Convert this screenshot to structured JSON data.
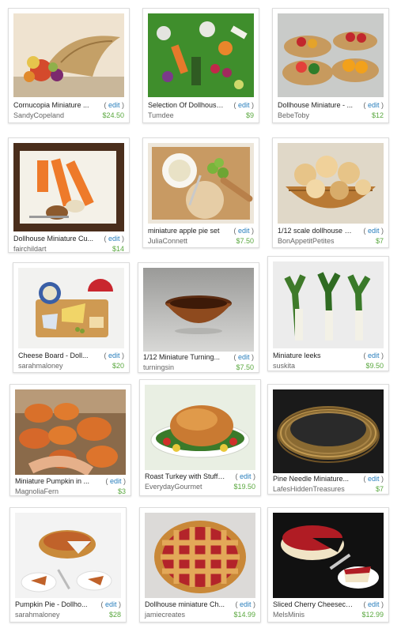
{
  "colors": {
    "edit": "#2a7fbd",
    "price": "#5aa83f",
    "shop": "#666666"
  },
  "edit_label": "edit",
  "items": [
    {
      "title": "Cornucopia Miniature ...",
      "shop": "SandyCopeland",
      "price": "$24.50",
      "icon": "cornucopia-image"
    },
    {
      "title": "Selection Of Dollhouse...",
      "shop": "Tumdee",
      "price": "$9",
      "icon": "vegetables-image"
    },
    {
      "title": "Dollhouse Miniature - ...",
      "shop": "BebeToby",
      "price": "$12",
      "icon": "fruit-baskets-image"
    },
    {
      "title": "Dollhouse Miniature Cu...",
      "shop": "fairchildart",
      "price": "$14",
      "icon": "cutting-board-image"
    },
    {
      "title": "miniature apple pie set",
      "shop": "JuliaConnett",
      "price": "$7.50",
      "icon": "apple-pie-set-image"
    },
    {
      "title": "1/12 scale dollhouse min...",
      "shop": "BonAppetitPetites",
      "price": "$7",
      "icon": "bread-basket-image"
    },
    {
      "title": "Cheese Board - Doll...",
      "shop": "sarahmaloney",
      "price": "$20",
      "icon": "cheese-board-image"
    },
    {
      "title": "1/12 Miniature Turning...",
      "shop": "turningsin",
      "price": "$7.50",
      "icon": "wooden-bowl-image"
    },
    {
      "title": "Miniature leeks",
      "shop": "suskita",
      "price": "$9.50",
      "icon": "leeks-image"
    },
    {
      "title": "Miniature Pumpkin in ...",
      "shop": "MagnoliaFern",
      "price": "$3",
      "icon": "pumpkins-image"
    },
    {
      "title": "Roast Turkey with Stuffing",
      "shop": "EverydayGourmet",
      "price": "$19.50",
      "icon": "roast-turkey-image"
    },
    {
      "title": "Pine Needle Miniature...",
      "shop": "LafesHiddenTreasures",
      "price": "$7",
      "icon": "pine-basket-image"
    },
    {
      "title": "Pumpkin Pie - Dollho...",
      "shop": "sarahmaloney",
      "price": "$28",
      "icon": "pumpkin-pie-image"
    },
    {
      "title": "Dollhouse miniature Ch...",
      "shop": "jamiecreates",
      "price": "$14.99",
      "icon": "cherry-pie-image"
    },
    {
      "title": "Sliced Cherry Cheesecake",
      "shop": "MelsMinis",
      "price": "$12.99",
      "icon": "cheesecake-image"
    }
  ]
}
